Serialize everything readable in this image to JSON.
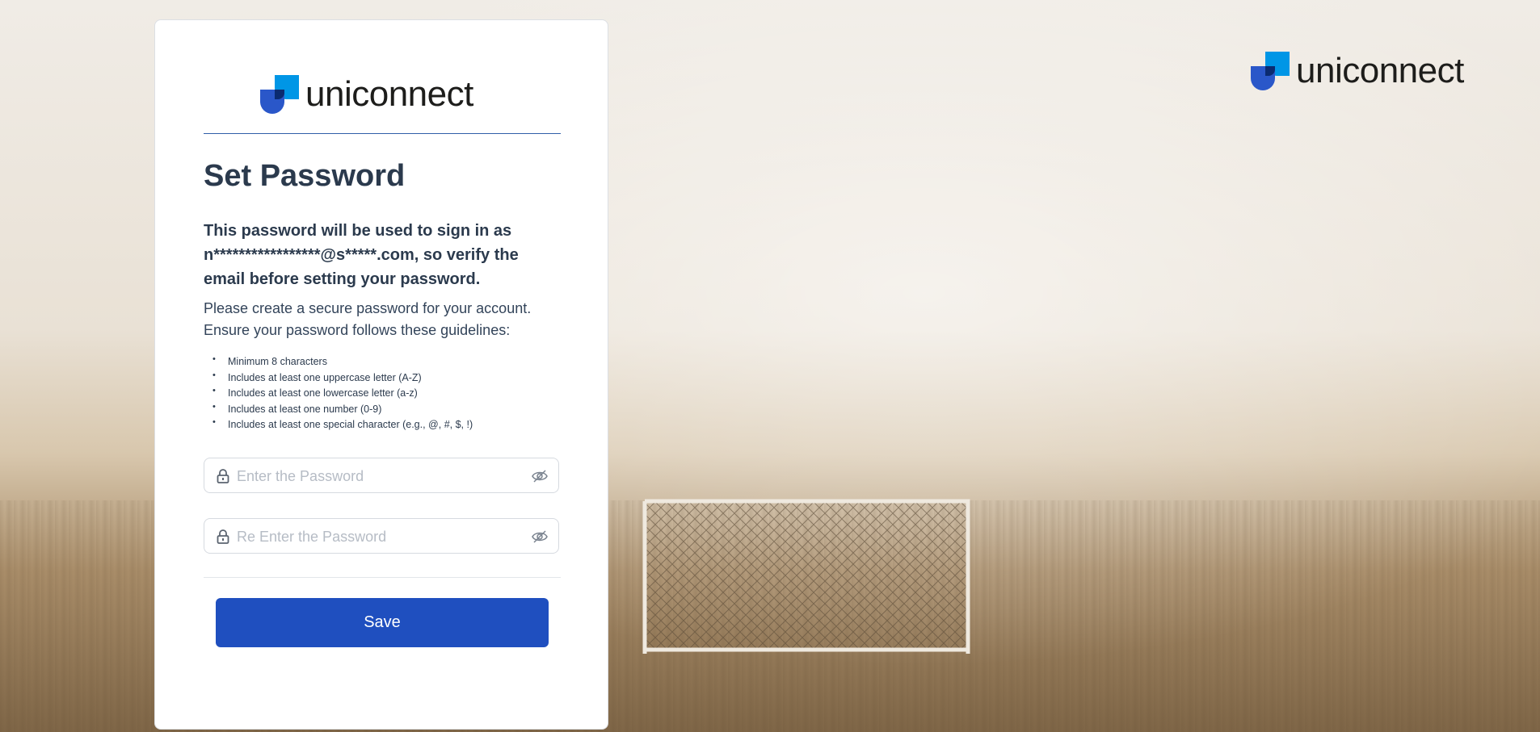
{
  "brand": {
    "name": "uniconnect"
  },
  "form": {
    "title": "Set Password",
    "intro_bold": "This password will be used to sign in as n*****************@s*****.com, so verify the email before setting your password.",
    "intro": "Please create a secure password for your account. Ensure your password follows these guidelines:",
    "rules": [
      "Minimum 8 characters",
      "Includes at least one uppercase letter (A-Z)",
      "Includes at least one lowercase letter (a-z)",
      "Includes at least one number (0-9)",
      "Includes at least one special character (e.g., @, #, $, !)"
    ],
    "password": {
      "value": "",
      "placeholder": "Enter the Password"
    },
    "confirm_password": {
      "value": "",
      "placeholder": "Re Enter the Password"
    },
    "save_label": "Save"
  },
  "icons": {
    "lock": "lock-icon",
    "visibility": "eye-off-icon",
    "logo": "uniconnect-logo-mark"
  },
  "colors": {
    "primary_button": "#1f4fbf",
    "logo_blue": "#0096e6",
    "logo_dark_blue": "#2a57c9",
    "title_text": "#2b3a4d",
    "divider_blue": "#2f5fa8"
  }
}
